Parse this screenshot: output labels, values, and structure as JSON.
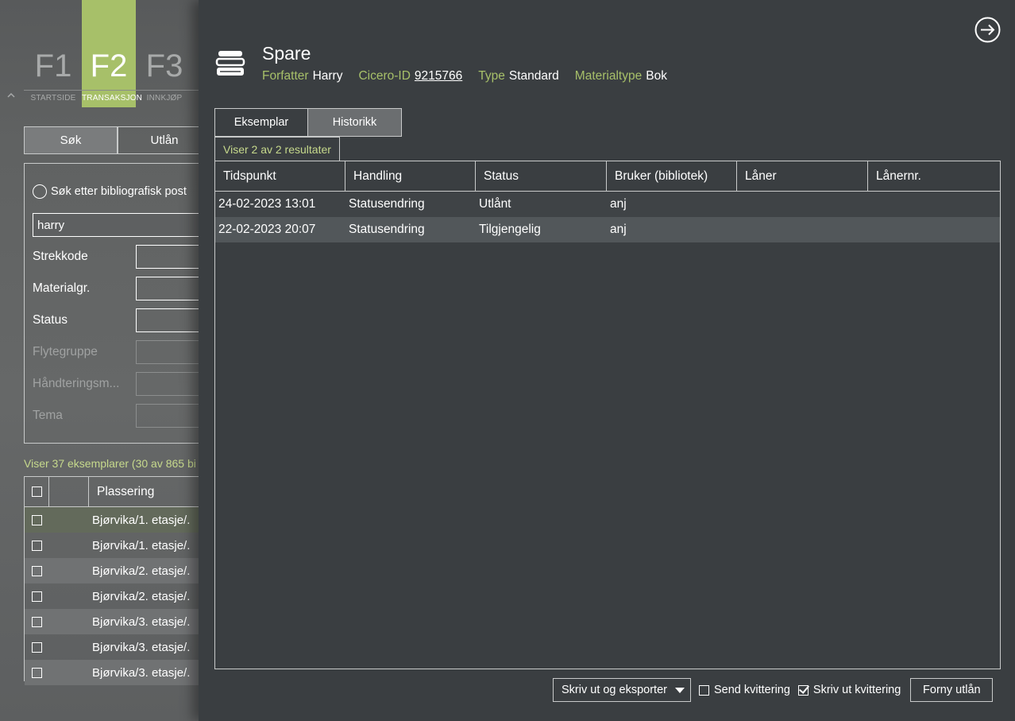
{
  "background_app": {
    "fkeys": [
      {
        "key": "F1",
        "label": "STARTSIDE"
      },
      {
        "key": "F2",
        "label": "TRANSAKSJON"
      },
      {
        "key": "F3",
        "label": "INNKJØP"
      }
    ],
    "tabs": [
      "Søk",
      "Utlån"
    ],
    "search_mode_label": "Søk etter bibliografisk post",
    "query_value": "harry",
    "filters": [
      {
        "label": "Strekkode",
        "enabled": true
      },
      {
        "label": "Materialgr.",
        "enabled": true
      },
      {
        "label": "Status",
        "enabled": true
      },
      {
        "label": "Flytegruppe",
        "enabled": false
      },
      {
        "label": "Håndteringsm...",
        "enabled": false
      },
      {
        "label": "Tema",
        "enabled": false
      }
    ],
    "result_summary": "Viser 37 eksemplarer (30 av 865 bi",
    "table_header": "Plassering",
    "rows": [
      "Bjørvika/1. etasje/.",
      "Bjørvika/1. etasje/.",
      "Bjørvika/2. etasje/.",
      "Bjørvika/2. etasje/.",
      "Bjørvika/3. etasje/.",
      "Bjørvika/3. etasje/.",
      "Bjørvika/3. etasje/."
    ]
  },
  "record": {
    "title": "Spare",
    "author_key": "Forfatter",
    "author": "Harry",
    "id_key": "Cicero-ID",
    "id": "9215766",
    "type_key": "Type",
    "type": "Standard",
    "material_key": "Materialtype",
    "material": "Bok"
  },
  "tabs": [
    {
      "label": "Eksemplar",
      "active": false
    },
    {
      "label": "Historikk",
      "active": true
    }
  ],
  "result_count_label": "Viser 2 av 2 resultater",
  "history_table": {
    "columns": [
      "Tidspunkt",
      "Handling",
      "Status",
      "Bruker (bibliotek)",
      "Låner",
      "Lånernr."
    ],
    "rows": [
      [
        "24-02-2023 13:01",
        "Statusendring",
        "Utlånt",
        "anj",
        "",
        ""
      ],
      [
        "22-02-2023 20:07",
        "Statusendring",
        "Tilgjengelig",
        "anj",
        "",
        ""
      ]
    ]
  },
  "actions": {
    "print_export": "Skriv ut og eksporter",
    "send_receipt": "Send kvittering",
    "send_receipt_checked": false,
    "print_receipt": "Skriv ut kvittering",
    "print_receipt_checked": true,
    "renew": "Forny utlån"
  }
}
